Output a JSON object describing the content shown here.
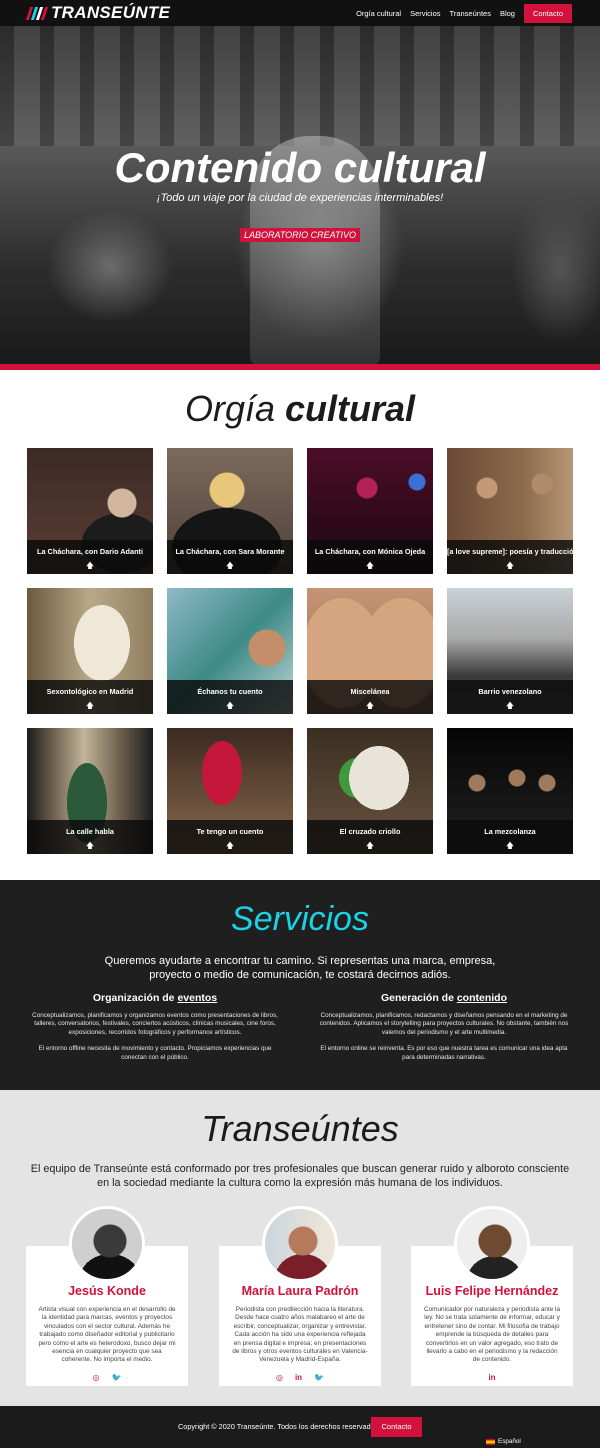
{
  "nav": {
    "brand": "TRANSEÚNTE",
    "links": [
      "Orgía cultural",
      "Servicios",
      "Transeúntes",
      "Blog"
    ],
    "cta": "Contacto"
  },
  "hero": {
    "title": "Contenido cultural",
    "subtitle": "¡Todo un viaje por la ciudad de experiencias interminables!",
    "badge": "LABORATORIO CREATIVO"
  },
  "orgia": {
    "title_light": "Orgía",
    "title_bold": "cultural",
    "items": [
      {
        "label": "La Cháchara, con Dario Adanti"
      },
      {
        "label": "La Cháchara, con Sara Morante"
      },
      {
        "label": "La Cháchara, con Mónica Ojeda"
      },
      {
        "label": "[a love supreme]: poesía y traducción"
      },
      {
        "label": "Sexontológico en Madrid"
      },
      {
        "label": "Échanos tu cuento"
      },
      {
        "label": "Miscelánea"
      },
      {
        "label": "Barrio venezolano"
      },
      {
        "label": "La calle habla"
      },
      {
        "label": "Te tengo un cuento"
      },
      {
        "label": "El cruzado criollo"
      },
      {
        "label": "La mezcolanza"
      }
    ],
    "arrow": "🡅"
  },
  "servicios": {
    "title": "Servicios",
    "lead": "Queremos ayudarte a encontrar tu camino. Si representas una marca, empresa, proyecto o medio de comunicación, te costará decirnos adiós.",
    "col1": {
      "heading_prefix": "Organización de",
      "heading_link": "eventos",
      "p1": "Conceptualizamos, planificamos y organizamos eventos como presentaciones de libros, talleres, conversatorios, festivales, conciertos acústicos, clínicas musicales, cine foros, exposiciones, recorridos fotográficos y performance artísticos.",
      "p2": "El entorno offline necesita de movimiento y contacto. Propiciamos experiencias que conectan con el público."
    },
    "col2": {
      "heading_prefix": "Generación de",
      "heading_link": "contenido",
      "p1": "Conceptualizamos, planificamos, redactamos y diseñamos pensando en el marketing de contenidos. Aplicamos el storytelling para proyectos culturales. No obstante, también nos valemos del periodismo y el arte multimedia.",
      "p2": "El entorno online se reinventa. Es por eso que nuestra tarea es comunicar una idea apta para determinadas narrativas."
    }
  },
  "transeuntes": {
    "title": "Transeúntes",
    "lead": "El equipo de Transeúnte está conformado por tres profesionales que buscan generar ruido y alboroto consciente en la sociedad mediante la cultura como la expresión más humana de los individuos.",
    "people": [
      {
        "name": "Jesús Konde",
        "bio": "Artista visual con experiencia en el desarrollo de la identidad para marcas, eventos y proyectos vinculados con el sector cultural. Además he trabajado como diseñador editorial y publicitario pero como el arte es heterodoxo, busco dejar mi esencia en cualquier proyecto que sea coherente. No importa el medio.",
        "social": [
          "◎",
          "🐦"
        ]
      },
      {
        "name": "María Laura Padrón",
        "bio": "Periodista con predilección hacia la literatura. Desde hace cuatro años malabareo el arte de escribir, conceptualizar, organizar y entrevistar. Cada acción ha sido una experiencia reflejada en prensa digital e impresa; en presentaciones de libros y otros eventos culturales en Valencia-Venezuela y Madrid-España.",
        "social": [
          "◎",
          "in",
          "🐦"
        ]
      },
      {
        "name": "Luis Felipe Hernández",
        "bio": "Comunicador por naturaleza y periodista ante la ley. No se trata solamente de informar, educar y entretener sino de contar. Mi filosofía de trabajo emprende la búsqueda de detalles para convertirlos en un valor agregado, eso trato de llevarlo a cabo en el periodismo y la redacción de contenido.",
        "social": [
          "in"
        ]
      }
    ]
  },
  "footer": {
    "copyright": "Copyright © 2020 Transeúnte. Todos los derechos reservados.",
    "cta": "Contacto",
    "language": "Español"
  },
  "colors": {
    "accent": "#d2123d",
    "cyan": "#19d3e6",
    "dark": "#1f1f1f"
  }
}
